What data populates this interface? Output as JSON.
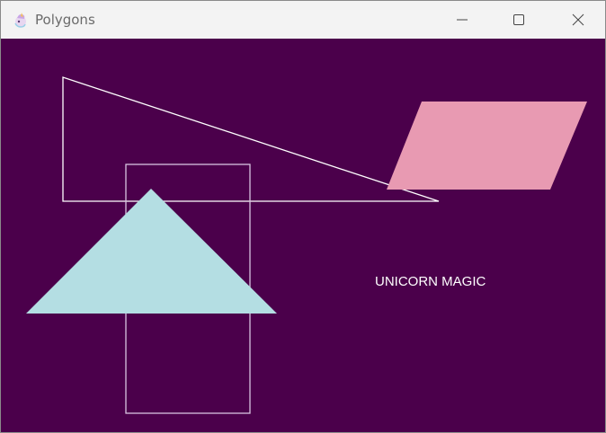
{
  "window": {
    "title": "Polygons",
    "app_icon": "unicorn-icon",
    "controls": {
      "minimize": "minimize-icon",
      "maximize": "maximize-icon",
      "close": "close-icon"
    }
  },
  "canvas": {
    "background": "#4b004b",
    "text": "UNICORN MAGIC",
    "text_color": "#ffffff",
    "shapes": [
      {
        "name": "outline-right-triangle",
        "fill": "none",
        "stroke": "#ffffff"
      },
      {
        "name": "outline-rectangle",
        "fill": "none",
        "stroke": "#d8c4e0"
      },
      {
        "name": "filled-triangle",
        "fill": "#b4dee3",
        "stroke": "none"
      },
      {
        "name": "filled-parallelogram",
        "fill": "#e89ab2",
        "stroke": "none"
      }
    ]
  }
}
